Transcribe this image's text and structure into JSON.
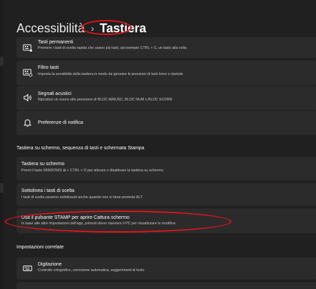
{
  "breadcrumb": {
    "root": "Accessibilità",
    "separator": "›",
    "current": "Tastiera"
  },
  "cards_top": [
    {
      "icon": "sticky-keys-icon",
      "title": "Tasti permanenti",
      "subtitle": "Premere i tasti di scelta rapida che usano più tasti, ad esempio CTRL + S, un tasto alla volta"
    },
    {
      "icon": "filter-keys-icon",
      "title": "Filtro tasti",
      "subtitle": "Imposta la sensibilità della tastiera in modo da ignorare le pressioni di tasti brevi o ripetute"
    },
    {
      "icon": "speaker-icon",
      "title": "Segnali acustici",
      "subtitle": "Riproduci un suono alla pressione di BLOC MAIUSC, BLOC NUM o BLOC SCORR"
    },
    {
      "icon": "bell-icon",
      "title": "Preferenze di notifica"
    }
  ],
  "section_screen_keyboard": "Tastiera su schermo, sequenza di tasti e schermata Stampa",
  "cards_screen": [
    {
      "title": "Tastiera su schermo",
      "subtitle": "Premi il tasto WINDOWS ⊞ + CTRL + O per attivare o disattivare la tastiera su schermo."
    },
    {
      "title": "Sottolinea i tasti di scelta",
      "subtitle": "I tasti di scelta saranno sottolineati anche quando non si tiene premuto ALT"
    },
    {
      "title": "Usa il pulsante STAMP per aprire Cattura schermo",
      "subtitle": "In base alle altre impostazioni dell'app, potresti dover riavviare il PC per visualizzare le modifica."
    }
  ],
  "section_related": "Impostazioni correlate",
  "cards_related": [
    {
      "icon": "keyboard-icon",
      "title": "Digitazione",
      "subtitle": "Controllo ortografico, correzione automatica, suggerimenti di testo"
    }
  ],
  "colors": {
    "background": "#202020",
    "card": "#2b2b2b",
    "highlight_oval": "#e0141b"
  }
}
